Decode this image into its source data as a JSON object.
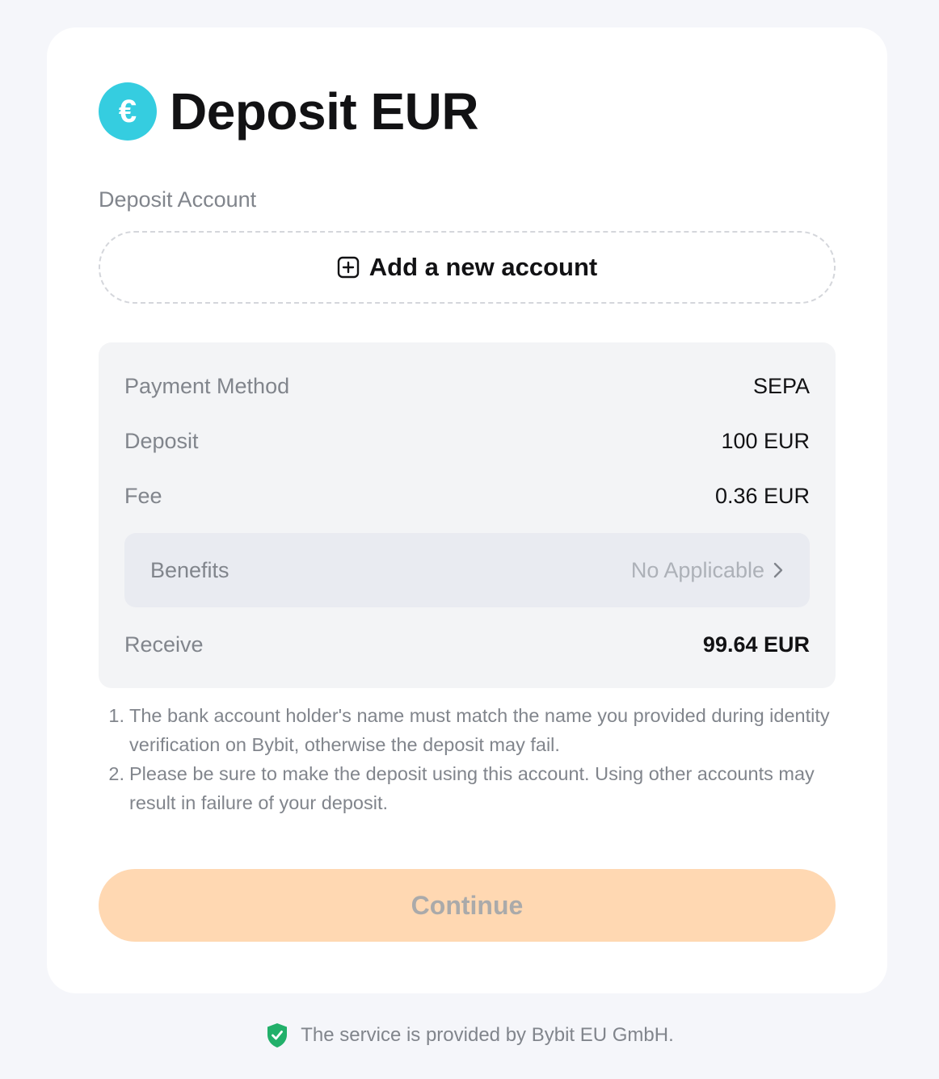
{
  "header": {
    "currency_symbol": "€",
    "title": "Deposit EUR"
  },
  "deposit_account": {
    "label": "Deposit Account",
    "add_button_label": "Add a new account"
  },
  "summary": {
    "payment_method": {
      "label": "Payment Method",
      "value": "SEPA"
    },
    "deposit": {
      "label": "Deposit",
      "value": "100 EUR"
    },
    "fee": {
      "label": "Fee",
      "value": "0.36 EUR"
    },
    "benefits": {
      "label": "Benefits",
      "value": "No Applicable"
    },
    "receive": {
      "label": "Receive",
      "value": "99.64 EUR"
    }
  },
  "notes": [
    {
      "num": "1.",
      "text": "The bank account holder's name must match the name you provided during identity verification on Bybit, otherwise the deposit may fail."
    },
    {
      "num": "2.",
      "text": "Please be sure to make the deposit using this account. Using other accounts may result in failure of your deposit."
    }
  ],
  "actions": {
    "continue_label": "Continue"
  },
  "footer": {
    "text": "The service is provided by Bybit EU GmbH."
  },
  "colors": {
    "accent_cyan": "#35cde0",
    "continue_bg_disabled": "#ffd8b2",
    "shield_green": "#22b06a"
  },
  "icons": {
    "currency": "euro-icon",
    "add": "plus-square-icon",
    "benefits_arrow": "chevron-right-icon",
    "footer": "shield-check-icon"
  }
}
